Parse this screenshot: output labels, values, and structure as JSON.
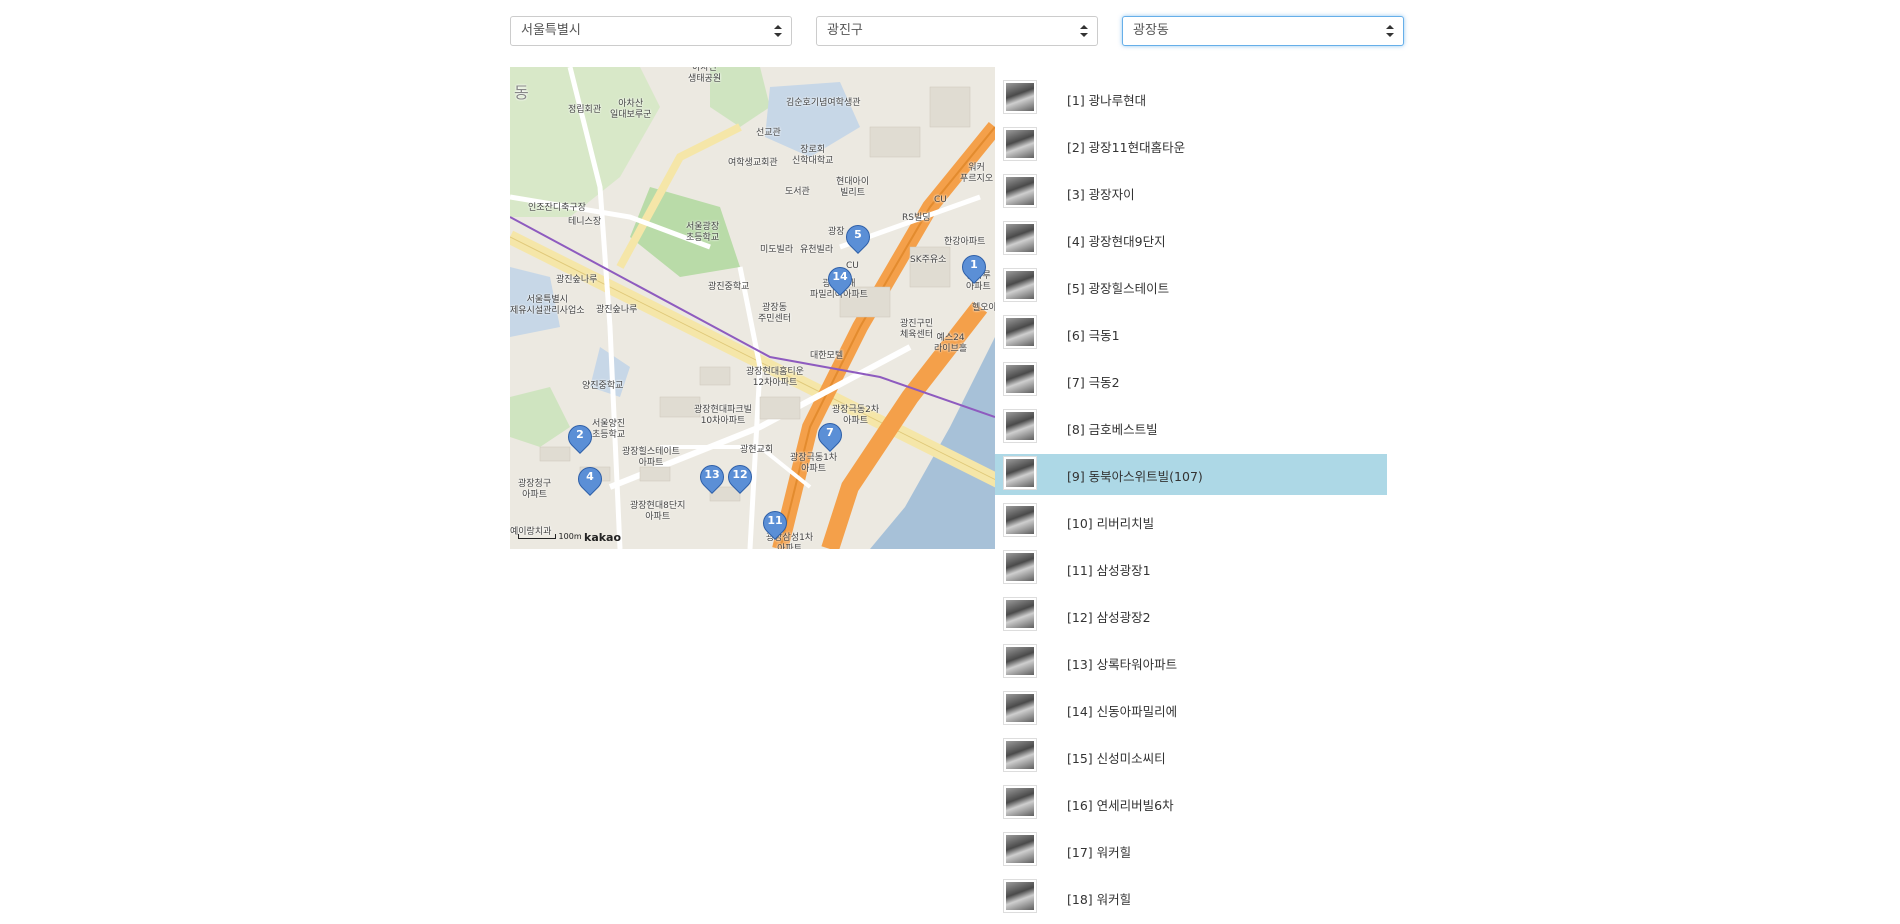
{
  "selects": {
    "city": "서울특별시",
    "district": "광진구",
    "dong": "광장동"
  },
  "map": {
    "labels": {
      "l1": "아차산\n생태공원",
      "l2": "아차산\n일대보루군",
      "l3": "정립회관",
      "l4": "동",
      "l5": "김순호기념여학생관",
      "l6": "선교관",
      "l7": "장로회\n신학대학교",
      "l8": "여학생교회관",
      "l9": "도서관",
      "l10": "현대아이\n빌리트",
      "l11": "인조잔디축구장",
      "l12": "테니스장",
      "l13": "서울광장\n초등학교",
      "l14": "미도빌라",
      "l15": "유천빌라",
      "l16": "광진중학교",
      "l17": "광장동\n주민센터",
      "l18": "광진숲나루",
      "l19": "서울특별시\n제유시설관리사업소",
      "l20": "광진숲나루",
      "l21": "양진중학교",
      "l22": "서울양진\n초등학교",
      "l23": "광장현대홈티운\n12차아파트",
      "l24": "광장현대파크빌\n10차아파트",
      "l25": "광장극동2차\n아파트",
      "l26": "광장힐스테이트\n아파트",
      "l27": "광현교회",
      "l28": "광장극동1차\n아파트",
      "l29": "광장청구\n아파트",
      "l30": "광장현대8단지\n아파트",
      "l31": "광장삼성1차\n아파트",
      "l32": "예이랑치과",
      "l33": "RS빌딩",
      "l34": "한강아파트",
      "l35": "SK주유소",
      "l36": "광진구민\n체육센터",
      "l37": "예스24\n라이브홀",
      "l38": "워커\n푸르지오",
      "l39": "대한모텔",
      "l40": "광나루\n아파트",
      "l41": "광장현대\n파밀리아아파트",
      "l42": "헬오아파트",
      "l43": "CU",
      "l44": "CU",
      "l45": "광장"
    },
    "markers": [
      "1",
      "2",
      "4",
      "5",
      "7",
      "11",
      "12",
      "13",
      "14"
    ],
    "scale_label": "100m",
    "provider": "kakao"
  },
  "list": [
    "[1] 광나루현대",
    "[2] 광장11현대홈타운",
    "[3] 광장자이",
    "[4] 광장현대9단지",
    "[5] 광장힐스테이트",
    "[6] 극동1",
    "[7] 극동2",
    "[8] 금호베스트빌",
    "[9] 동북아스위트빌(107)",
    "[10] 리버리치빌",
    "[11] 삼성광장1",
    "[12] 삼성광장2",
    "[13] 상록타워아파트",
    "[14] 신동아파밀리에",
    "[15] 신성미소씨티",
    "[16] 연세리버빌6차",
    "[17] 워커힐",
    "[18] 워커힐"
  ],
  "selected_index": 8,
  "colors": {
    "selected_row": "#add8e6",
    "focus_border": "#66afe9",
    "marker": "#5b8fd6"
  }
}
